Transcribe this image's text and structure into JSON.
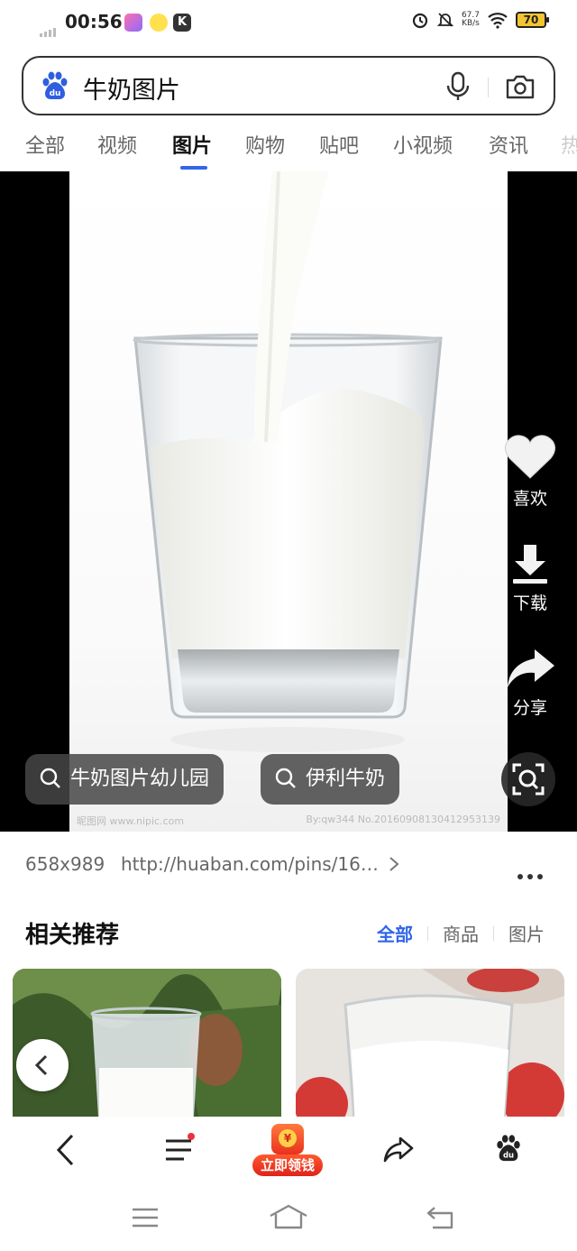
{
  "status_bar": {
    "time": "00:56",
    "net_speed_value": "67.7",
    "net_speed_unit": "KB/s",
    "battery": "70"
  },
  "search": {
    "query": "牛奶图片"
  },
  "tabs": [
    {
      "label": "全部"
    },
    {
      "label": "视频"
    },
    {
      "label": "图片",
      "active": true
    },
    {
      "label": "购物"
    },
    {
      "label": "贴吧"
    },
    {
      "label": "小视频"
    },
    {
      "label": "资讯"
    },
    {
      "label": "热"
    }
  ],
  "viewer": {
    "actions": {
      "like": "喜欢",
      "download": "下载",
      "share": "分享"
    },
    "suggestions": [
      "牛奶图片幼儿园",
      "伊利牛奶"
    ],
    "watermark_left": "昵图网 www.nipic.com",
    "watermark_right": "By:qw344 No.20160908130412953139"
  },
  "image_info": {
    "dimensions": "658x989",
    "source_url": "http://huaban.com/pins/16…"
  },
  "related": {
    "title": "相关推荐",
    "filters": [
      {
        "label": "全部",
        "active": true
      },
      {
        "label": "商品"
      },
      {
        "label": "图片"
      }
    ]
  },
  "toolbar": {
    "reward_label": "立即领钱",
    "reward_coin": "¥"
  },
  "colors": {
    "accent": "#3166e8",
    "reward": "#e8311e"
  }
}
